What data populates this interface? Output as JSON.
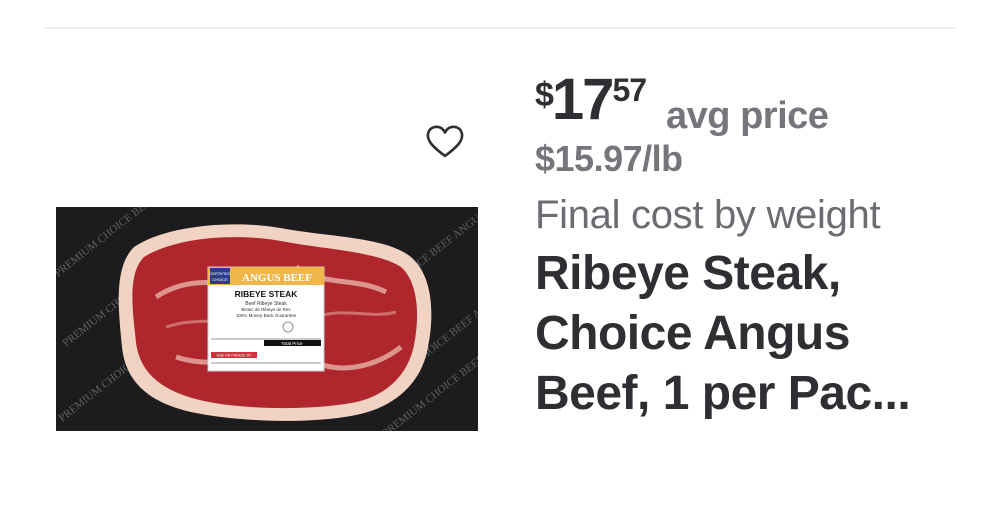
{
  "product": {
    "price_currency": "$",
    "price_dollars": "17",
    "price_cents": "57",
    "price_qualifier": "avg price",
    "unit_price": "$15.97/lb",
    "pricing_note": "Final cost by weight",
    "title_lines": [
      "Ribeye Steak,",
      "Choice Angus",
      "Beef, 1 per Pac..."
    ]
  },
  "image": {
    "alt": "Ribeye Steak package",
    "label_brand": "ANGUS BEEF",
    "label_badge_top": "CERTIFIED",
    "label_badge_bottom": "CHOICE",
    "label_title": "RIBEYE STEAK",
    "label_sub1": "Beef Ribeye Steak",
    "label_sub2": "Bistec de Ribeye de Res",
    "label_sub3": "100% Money-Back Guarantee",
    "label_total": "Total Price",
    "label_use": "USE OR FREEZE BY",
    "wrap_text": "PREMIUM CHOICE BEEF ANGUS"
  },
  "favorite": {
    "icon": "heart-outline-icon"
  },
  "colors": {
    "price": "#2e2f32",
    "secondary": "#74767c",
    "divider": "#ececec"
  }
}
